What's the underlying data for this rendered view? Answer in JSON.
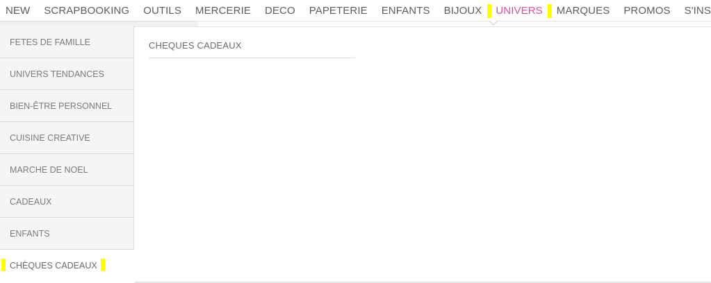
{
  "topnav": {
    "items": [
      {
        "label": "NEW"
      },
      {
        "label": "SCRAPBOOKING"
      },
      {
        "label": "OUTILS"
      },
      {
        "label": "MERCERIE"
      },
      {
        "label": "DECO"
      },
      {
        "label": "PAPETERIE"
      },
      {
        "label": "ENFANTS"
      },
      {
        "label": "BIJOUX"
      },
      {
        "label": "UNIVERS",
        "active": true
      },
      {
        "label": "MARQUES"
      },
      {
        "label": "PROMOS"
      },
      {
        "label": "S'INSPIRER"
      }
    ]
  },
  "sidebar": {
    "items": [
      {
        "label": "FETES DE FAMILLE"
      },
      {
        "label": "UNIVERS TENDANCES"
      },
      {
        "label": "BIEN-ÊTRE PERSONNEL"
      },
      {
        "label": "CUISINE CREATIVE"
      },
      {
        "label": "MARCHE DE NOEL"
      },
      {
        "label": "CADEAUX"
      },
      {
        "label": "ENFANTS"
      },
      {
        "label": "CHÈQUES CADEAUX",
        "active": true
      }
    ]
  },
  "content": {
    "heading": "CHEQUES CADEAUX"
  },
  "colors": {
    "accent": "#d84f9e",
    "highlight": "#ffff00",
    "nav_text": "#5c5c5c",
    "sidebar_bg": "#f5f5f5"
  }
}
